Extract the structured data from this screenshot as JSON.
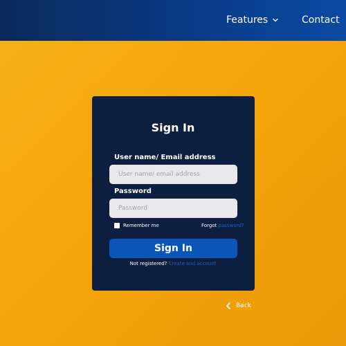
{
  "nav": {
    "features_label": "Features",
    "contact_label": "Contact",
    "features_icon": "chevron-down-icon"
  },
  "form": {
    "title": "Sign In",
    "username_label": "User name/ Email address",
    "username_placeholder": "User name/ email address",
    "password_label": "Password",
    "password_placeholder": "Password",
    "remember_label": "Remember me",
    "forgot_prefix": "Forgot",
    "forgot_link": "password?",
    "submit_label": "Sign In",
    "not_registered_text": "Not registered?",
    "create_account_link": "Create and account"
  },
  "back": {
    "label": "Back",
    "icon": "chevron-left-icon"
  },
  "colors": {
    "topbar": "#0b3a86",
    "background": "#f5a40b",
    "card": "#0c1f3f",
    "button": "#0a56b9",
    "input": "#e9e9ec",
    "link": "#1f5fc7"
  }
}
